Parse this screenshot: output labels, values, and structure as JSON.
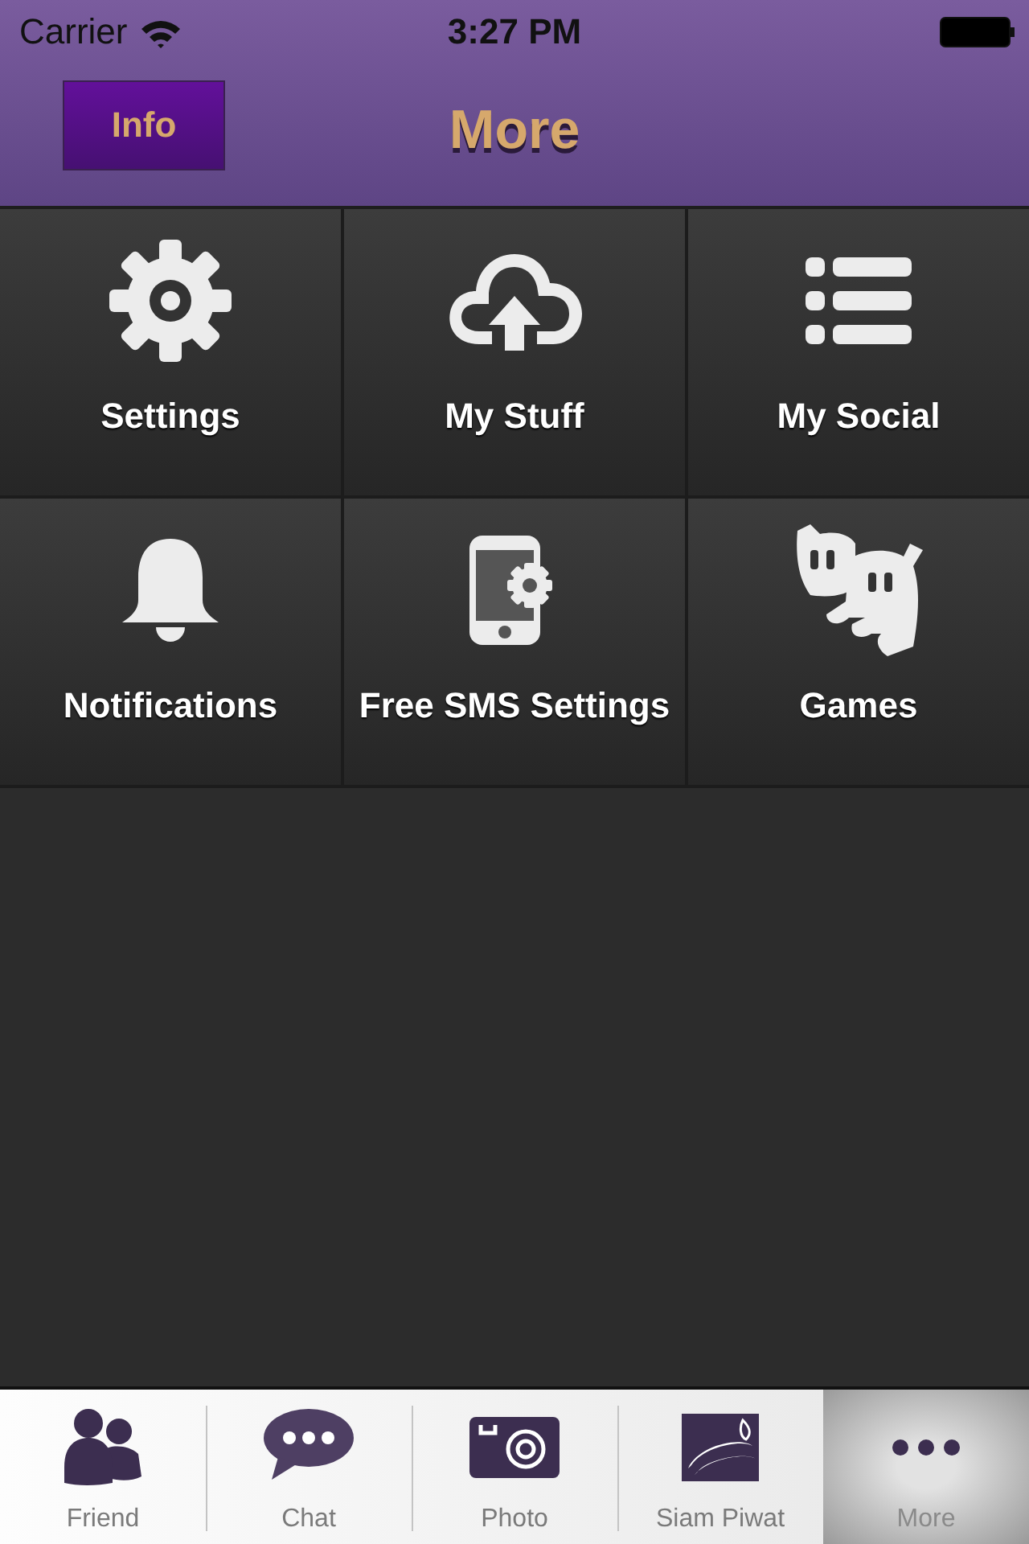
{
  "status_bar": {
    "carrier": "Carrier",
    "time": "3:27 PM"
  },
  "nav_bar": {
    "button": "Info",
    "title": "More"
  },
  "tiles": [
    {
      "label": "Settings",
      "kind": "gear"
    },
    {
      "label": "My Stuff",
      "kind": "cloud"
    },
    {
      "label": "My Social",
      "kind": "list"
    },
    {
      "label": "Notifications",
      "kind": "bell"
    },
    {
      "label": "Free SMS Settings",
      "kind": "phone"
    },
    {
      "label": "Games",
      "kind": "games"
    }
  ],
  "tab_bar": [
    {
      "label": "Friend",
      "kind": "friends",
      "selected": false
    },
    {
      "label": "Chat",
      "kind": "chat",
      "selected": false
    },
    {
      "label": "Photo",
      "kind": "camera",
      "selected": false
    },
    {
      "label": "Siam Piwat",
      "kind": "emblem",
      "selected": false
    },
    {
      "label": "More",
      "kind": "more",
      "selected": true
    }
  ]
}
